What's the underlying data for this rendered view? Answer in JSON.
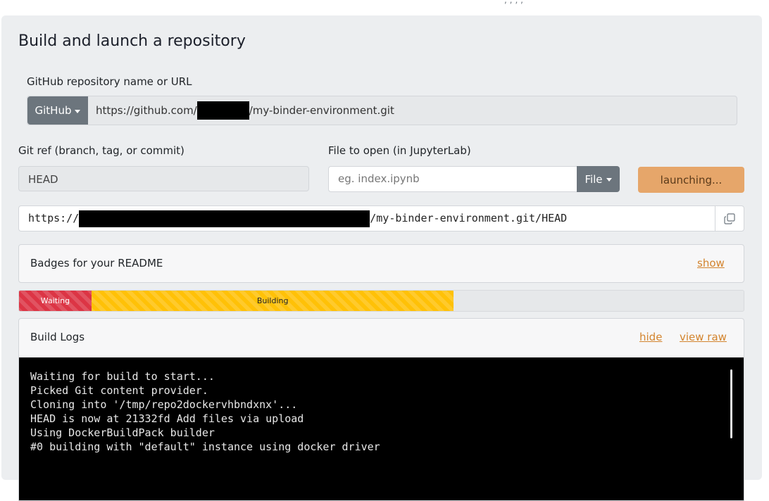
{
  "top_fragment": ", ;  , ,",
  "form": {
    "title": "Build and launch a repository",
    "repo_label": "GitHub repository name or URL",
    "provider_label": "GitHub",
    "repo_url_prefix": "https://github.com/",
    "repo_url_suffix": "/my-binder-environment.git",
    "gitref_label": "Git ref (branch, tag, or commit)",
    "gitref_value": "HEAD",
    "file_label": "File to open (in JupyterLab)",
    "file_placeholder": "eg. index.ipynb",
    "file_button_label": "File",
    "launch_button_label": "launching..."
  },
  "share_url": {
    "prefix": "https://",
    "suffix": "/my-binder-environment.git/HEAD"
  },
  "badges": {
    "title": "Badges for your README",
    "toggle_label": "show"
  },
  "progress": {
    "segments": [
      {
        "label": "Waiting",
        "fraction": 0.1
      },
      {
        "label": "Building",
        "fraction": 0.5
      }
    ]
  },
  "logs": {
    "title": "Build Logs",
    "hide_label": "hide",
    "view_raw_label": "view raw",
    "lines": [
      "Waiting for build to start...",
      "Picked Git content provider.",
      "Cloning into '/tmp/repo2dockervhbndxnx'...",
      "HEAD is now at 21332fd Add files via upload",
      "Using DockerBuildPack builder",
      "#0 building with \"default\" instance using docker driver"
    ]
  }
}
